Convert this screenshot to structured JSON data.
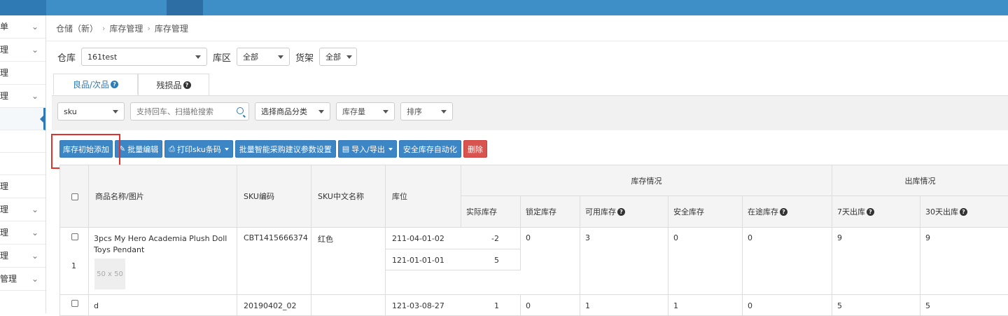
{
  "breadcrumb": {
    "home": "仓储（新）",
    "section": "库存管理",
    "page": "库存管理"
  },
  "filters": {
    "warehouse_label": "仓库",
    "warehouse_value": "161test",
    "zone_label": "库区",
    "zone_value": "全部",
    "shelf_label": "货架",
    "shelf_value": "全部"
  },
  "tabs": [
    {
      "label": "良品/次品"
    },
    {
      "label": "残损品"
    }
  ],
  "search_bar": {
    "field_select": "sku",
    "search_placeholder": "支持回车、扫描枪搜索",
    "category_select": "选择商品分类",
    "stock_select": "库存量",
    "sort_select": "排序"
  },
  "actions": {
    "init_add": "库存初始添加",
    "bulk_edit": "批量编辑",
    "print_sku": "打印sku条码",
    "bulk_smart": "批量智能采购建议参数设置",
    "import_export": "导入/导出",
    "safety_auto": "安全库存自动化",
    "delete": "删除"
  },
  "table": {
    "headers": {
      "name_image": "商品名称/图片",
      "sku": "SKU编码",
      "sku_cn": "SKU中文名称",
      "location": "库位",
      "stock_group": "库存情况",
      "outbound_group": "出库情况",
      "actual": "实际库存",
      "locked": "锁定库存",
      "available": "可用库存",
      "safety": "安全库存",
      "in_transit": "在途库存",
      "out_7": "7天出库",
      "out_30": "30天出库"
    },
    "rows": [
      {
        "index": "1",
        "name": "3pcs My Hero Academia Plush Doll Toys Pendant",
        "thumb": "50 x 50",
        "sku": "CBT1415666374",
        "sku_cn": "红色",
        "loc1": "211-04-01-02",
        "qty1": "-2",
        "loc2": "121-01-01-01",
        "qty2": "5",
        "locked": "0",
        "available": "3",
        "safety": "0",
        "in_transit": "0",
        "out_7": "9",
        "out_30": "9"
      },
      {
        "name": "d",
        "sku": "20190402_02",
        "loc1": "121-03-08-27",
        "qty1": "1",
        "locked": "0",
        "available": "1",
        "safety": "1",
        "in_transit": "0",
        "out_7": "5",
        "out_30": "5"
      }
    ]
  },
  "colors": {
    "primary": "#3d86c6",
    "danger": "#d9534f",
    "highlight": "#e0332f",
    "topbar": "#3e8ec7"
  }
}
